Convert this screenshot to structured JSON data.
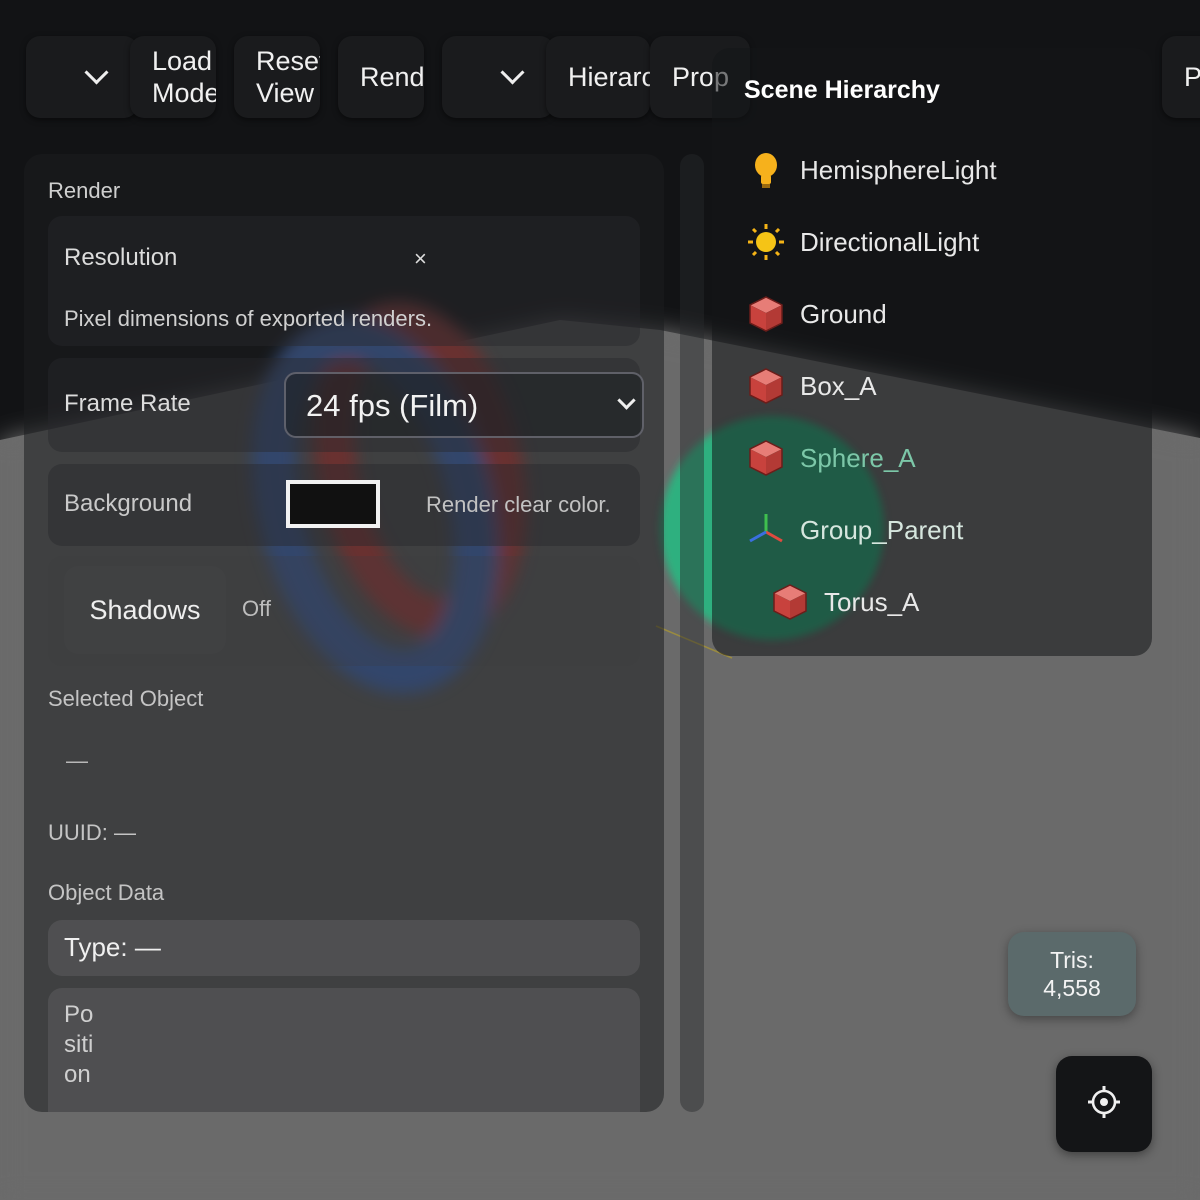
{
  "toolbar": {
    "load_model": "Load Model",
    "reset_view": "Reset View",
    "render": "Rende",
    "hierarchy": "Hierarc",
    "properties": "Prop",
    "right_edge": "P"
  },
  "render_panel": {
    "section_title": "Render",
    "resolution": {
      "label": "Resolution",
      "close": "×",
      "hint": "Pixel dimensions of exported renders."
    },
    "frame_rate": {
      "label": "Frame Rate",
      "value": "24 fps (Film)"
    },
    "background": {
      "label": "Background",
      "hint": "Render clear color.",
      "color": "#111111"
    },
    "shadows": {
      "label": "Shadows",
      "state": "Off"
    }
  },
  "selected_object": {
    "section_title": "Selected Object",
    "name": "—",
    "uuid": "UUID: —"
  },
  "object_data": {
    "section_title": "Object Data",
    "type": "Type: —",
    "position_label": "Position"
  },
  "hierarchy": {
    "title": "Scene Hierarchy",
    "items": [
      {
        "name": "HemisphereLight",
        "icon": "lightbulb-icon"
      },
      {
        "name": "DirectionalLight",
        "icon": "sun-icon"
      },
      {
        "name": "Ground",
        "icon": "cube-icon"
      },
      {
        "name": "Box_A",
        "icon": "cube-icon"
      },
      {
        "name": "Sphere_A",
        "icon": "cube-icon"
      },
      {
        "name": "Group_Parent",
        "icon": "axes-icon"
      },
      {
        "name": "Torus_A",
        "icon": "cube-icon"
      }
    ]
  },
  "stats": {
    "tris_label": "Tris:",
    "tris_value": "4,558"
  },
  "colors": {
    "accent_torus_outer": "#4f78c8",
    "accent_torus_inner": "#c84a44",
    "sphere": "#2fb07f",
    "cube": "#d9534f"
  }
}
